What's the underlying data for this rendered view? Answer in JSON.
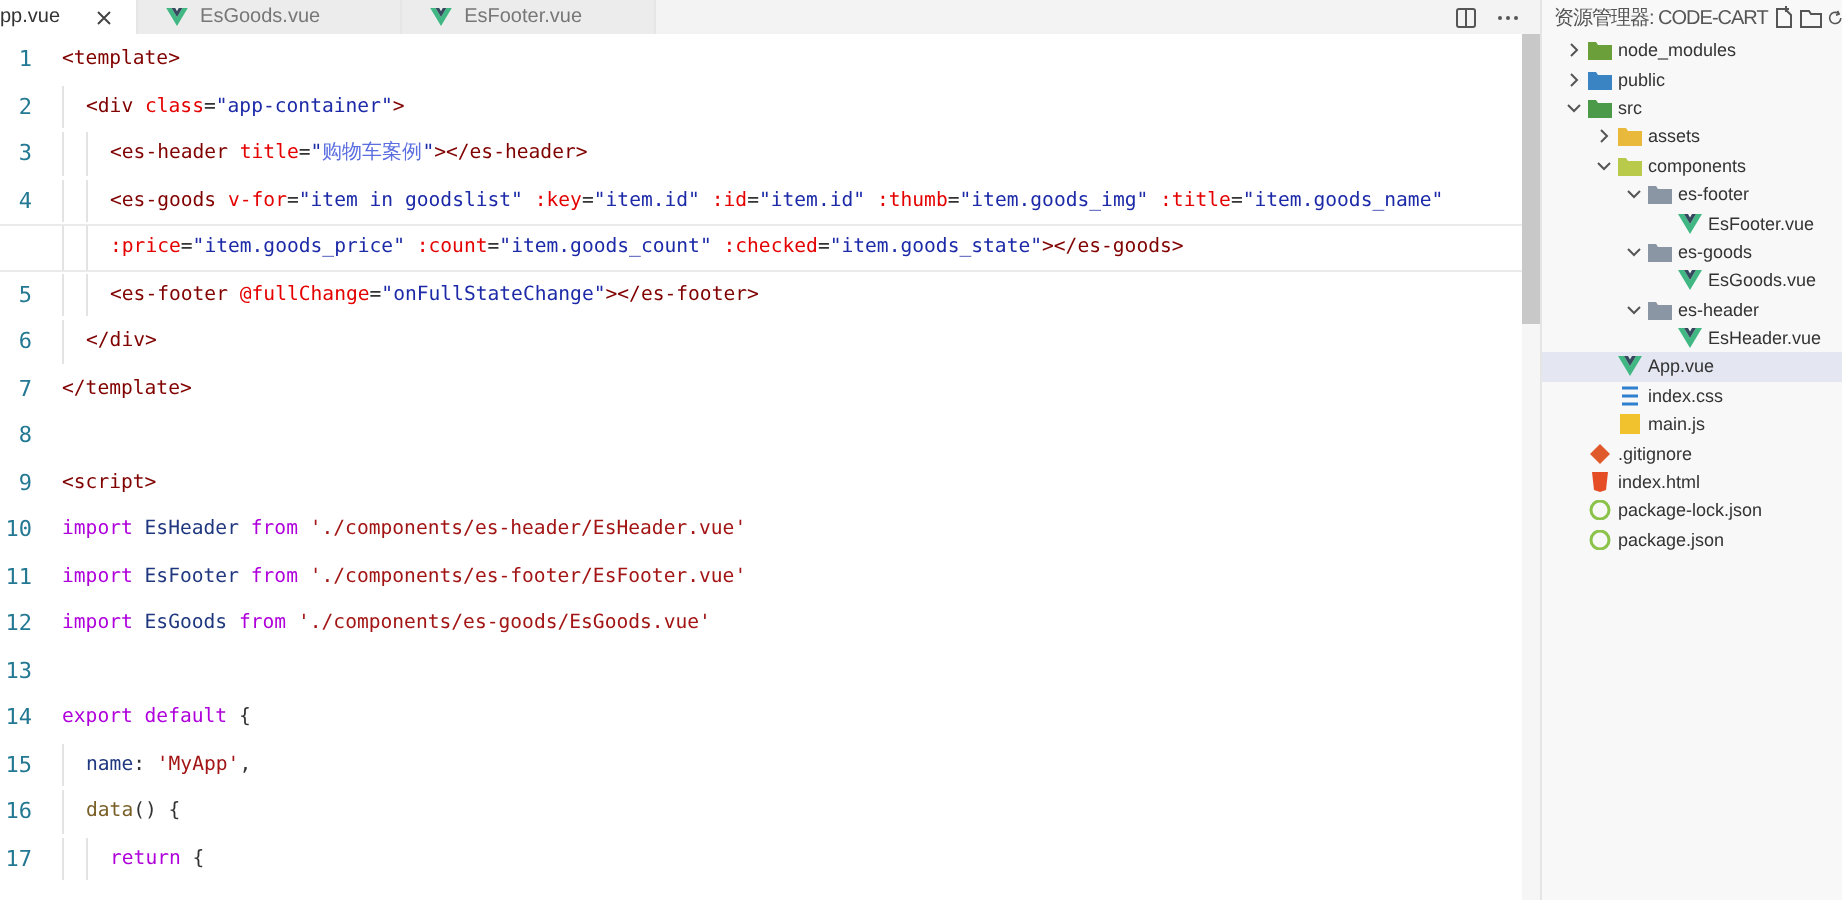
{
  "tabs": [
    {
      "label": "pp.vue",
      "selected": true
    },
    {
      "label": "EsGoods.vue",
      "selected": false,
      "kind": "vue"
    },
    {
      "label": "EsFooter.vue",
      "selected": false,
      "kind": "vue"
    }
  ],
  "code": [
    {
      "number": "1",
      "tokens": [
        {
          "kind": "tag",
          "text": "<template>"
        }
      ],
      "children": [
        {
          "number": "2",
          "tokens": [
            {
              "kind": "tag",
              "text": "<div"
            },
            {
              "kind": "attr",
              "text": " class"
            },
            {
              "kind": "plain",
              "text": "="
            },
            {
              "kind": "str",
              "text": "\"app-container\""
            },
            {
              "kind": "tag",
              "text": ">"
            }
          ],
          "children": [
            {
              "number": "3",
              "tokens": [
                {
                  "kind": "tag",
                  "text": "<es-header"
                },
                {
                  "kind": "attr",
                  "text": " title"
                },
                {
                  "kind": "plain",
                  "text": "="
                },
                {
                  "kind": "str",
                  "text": "\""
                },
                {
                  "kind": "cjk",
                  "text": "购物车案例"
                },
                {
                  "kind": "str",
                  "text": "\""
                },
                {
                  "kind": "tag",
                  "text": "></es-header>"
                }
              ]
            },
            {
              "number": "4",
              "tokens": [
                {
                  "kind": "tag",
                  "text": "<es-goods"
                },
                {
                  "kind": "attr",
                  "text": " v-for"
                },
                {
                  "kind": "plain",
                  "text": "="
                },
                {
                  "kind": "str",
                  "text": "\"item in goodslist\""
                },
                {
                  "kind": "attr",
                  "text": " :key"
                },
                {
                  "kind": "plain",
                  "text": "="
                },
                {
                  "kind": "str",
                  "text": "\"item.id\""
                },
                {
                  "kind": "attr",
                  "text": " :id"
                },
                {
                  "kind": "plain",
                  "text": "="
                },
                {
                  "kind": "str",
                  "text": "\"item.id\""
                },
                {
                  "kind": "attr",
                  "text": " :thumb"
                },
                {
                  "kind": "plain",
                  "text": "="
                },
                {
                  "kind": "str",
                  "text": "\"item.goods_img\""
                },
                {
                  "kind": "attr",
                  "text": " :title"
                },
                {
                  "kind": "plain",
                  "text": "="
                },
                {
                  "kind": "str",
                  "text": "\"item.goods_name\""
                }
              ]
            },
            {
              "current": true,
              "tokens": [
                {
                  "kind": "attr",
                  "text": ":price"
                },
                {
                  "kind": "plain",
                  "text": "="
                },
                {
                  "kind": "str",
                  "text": "\"item.goods_price\""
                },
                {
                  "kind": "attr",
                  "text": " :count"
                },
                {
                  "kind": "plain",
                  "text": "="
                },
                {
                  "kind": "str",
                  "text": "\"item.goods_count\""
                },
                {
                  "kind": "attr",
                  "text": " :checked"
                },
                {
                  "kind": "plain",
                  "text": "="
                },
                {
                  "kind": "str",
                  "text": "\"item.goods_state\""
                },
                {
                  "kind": "tag",
                  "text": "></es-goods>"
                }
              ]
            },
            {
              "number": "5",
              "tokens": [
                {
                  "kind": "tag",
                  "text": "<es-footer"
                },
                {
                  "kind": "attr",
                  "text": " @fullChange"
                },
                {
                  "kind": "plain",
                  "text": "="
                },
                {
                  "kind": "str",
                  "text": "\"onFullStateChange\""
                },
                {
                  "kind": "tag",
                  "text": "></es-footer>"
                }
              ]
            }
          ]
        },
        {
          "number": "6",
          "tokens": [
            {
              "kind": "tag",
              "text": "</div>"
            }
          ]
        }
      ]
    },
    {
      "number": "7",
      "tokens": [
        {
          "kind": "tag",
          "text": "</template>"
        }
      ]
    },
    {
      "number": "8"
    },
    {
      "number": "9",
      "tokens": [
        {
          "kind": "tag",
          "text": "<script>"
        }
      ]
    },
    {
      "number": "10",
      "tokens": [
        {
          "kind": "kw",
          "text": "import"
        },
        {
          "kind": "ident",
          "text": " EsHeader "
        },
        {
          "kind": "kw",
          "text": "from"
        },
        {
          "kind": "sstr",
          "text": " './components/es-header/EsHeader.vue'"
        }
      ]
    },
    {
      "number": "11",
      "tokens": [
        {
          "kind": "kw",
          "text": "import"
        },
        {
          "kind": "ident",
          "text": " EsFooter "
        },
        {
          "kind": "kw",
          "text": "from"
        },
        {
          "kind": "sstr",
          "text": " './components/es-footer/EsFooter.vue'"
        }
      ]
    },
    {
      "number": "12",
      "tokens": [
        {
          "kind": "kw",
          "text": "import"
        },
        {
          "kind": "ident",
          "text": " EsGoods "
        },
        {
          "kind": "kw",
          "text": "from"
        },
        {
          "kind": "sstr",
          "text": " './components/es-goods/EsGoods.vue'"
        }
      ]
    },
    {
      "number": "13"
    },
    {
      "number": "14",
      "tokens": [
        {
          "kind": "kw",
          "text": "export default"
        },
        {
          "kind": "plain",
          "text": " {"
        }
      ],
      "children": [
        {
          "number": "15",
          "tokens": [
            {
              "kind": "ident",
              "text": "name"
            },
            {
              "kind": "plain",
              "text": ": "
            },
            {
              "kind": "sstr",
              "text": "'MyApp'"
            },
            {
              "kind": "plain",
              "text": ","
            }
          ]
        },
        {
          "number": "16",
          "tokens": [
            {
              "kind": "fn",
              "text": "data"
            },
            {
              "kind": "plain",
              "text": "() {"
            }
          ],
          "children": [
            {
              "number": "17",
              "tokens": [
                {
                  "kind": "kw",
                  "text": "return"
                },
                {
                  "kind": "plain",
                  "text": " {"
                }
              ]
            }
          ]
        }
      ]
    }
  ],
  "explorer": {
    "title": "资源管理器: CODE-CART",
    "items": [
      {
        "label": "node_modules",
        "kind": "folder",
        "color": "#6a9f3a",
        "expanded": false,
        "selected": false
      },
      {
        "label": "public",
        "kind": "folder",
        "color": "#3b84c4",
        "expanded": false,
        "selected": false
      },
      {
        "label": "src",
        "kind": "folder",
        "color": "#4a9a4a",
        "expanded": true,
        "selected": false,
        "children": [
          {
            "label": "assets",
            "kind": "folder",
            "color": "#e8b93a",
            "expanded": false,
            "selected": false
          },
          {
            "label": "components",
            "kind": "folder",
            "color": "#b9c94a",
            "expanded": true,
            "selected": false,
            "children": [
              {
                "label": "es-footer",
                "kind": "folder",
                "color": "#8a96a3",
                "expanded": true,
                "selected": false,
                "children": [
                  {
                    "label": "EsFooter.vue",
                    "kind": "vue",
                    "selected": false
                  }
                ]
              },
              {
                "label": "es-goods",
                "kind": "folder",
                "color": "#8a96a3",
                "expanded": true,
                "selected": false,
                "children": [
                  {
                    "label": "EsGoods.vue",
                    "kind": "vue",
                    "selected": false
                  }
                ]
              },
              {
                "label": "es-header",
                "kind": "folder",
                "color": "#8a96a3",
                "expanded": true,
                "selected": false,
                "children": [
                  {
                    "label": "EsHeader.vue",
                    "kind": "vue",
                    "selected": false
                  }
                ]
              }
            ]
          },
          {
            "label": "App.vue",
            "kind": "vue",
            "selected": true
          },
          {
            "label": "index.css",
            "kind": "css",
            "selected": false
          },
          {
            "label": "main.js",
            "kind": "js",
            "selected": false
          }
        ]
      },
      {
        "label": ".gitignore",
        "kind": "git",
        "selected": false
      },
      {
        "label": "index.html",
        "kind": "html",
        "selected": false
      },
      {
        "label": "package-lock.json",
        "kind": "json",
        "selected": false
      },
      {
        "label": "package.json",
        "kind": "json",
        "selected": false
      }
    ]
  }
}
